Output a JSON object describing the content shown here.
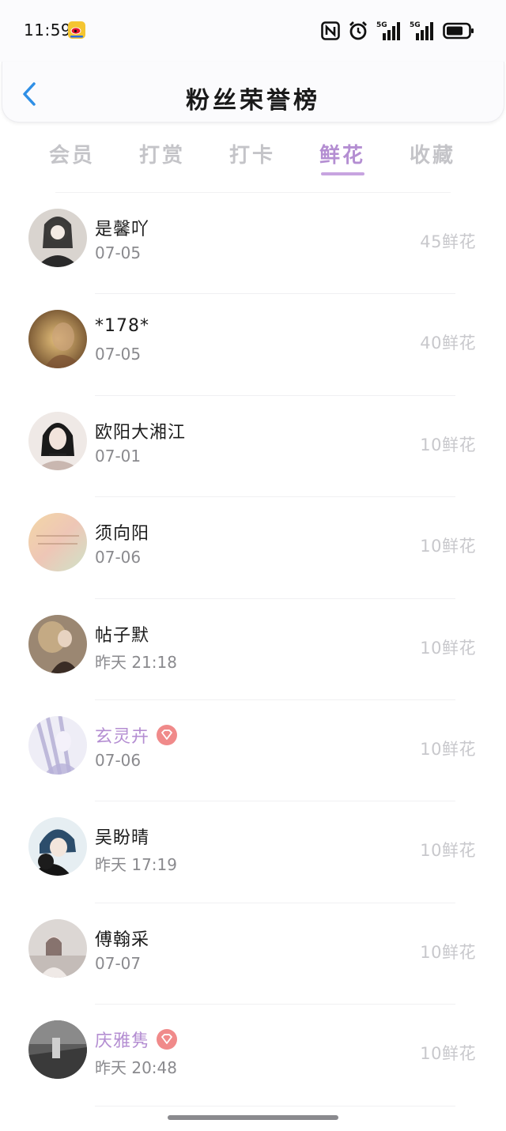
{
  "status_bar": {
    "time": "11:59",
    "icons": [
      "weibo-app-icon",
      "nfc-icon",
      "alarm-icon",
      "signal-5g-icon",
      "signal-5g-icon",
      "battery-icon"
    ],
    "signal_1_label": "5G",
    "signal_2_label": "5G"
  },
  "header": {
    "back_icon": "chevron-left-icon",
    "title": "粉丝荣誉榜"
  },
  "tabs": [
    {
      "label": "会员",
      "active": false
    },
    {
      "label": "打赏",
      "active": false
    },
    {
      "label": "打卡",
      "active": false
    },
    {
      "label": "鲜花",
      "active": true
    },
    {
      "label": "收藏",
      "active": false
    }
  ],
  "colors": {
    "accent": "#b48ed2",
    "tab_inactive": "#c4c4c8",
    "vip_badge": "#f08a8a",
    "date": "#8a8a8e",
    "flower_count": "#c8c8cc"
  },
  "fans": [
    {
      "name": "是馨吖",
      "date": "07-05",
      "flowers": "45鲜花",
      "vip": false
    },
    {
      "name": "*178*",
      "date": "07-05",
      "flowers": "40鲜花",
      "vip": false
    },
    {
      "name": "欧阳大湘江",
      "date": "07-01",
      "flowers": "10鲜花",
      "vip": false
    },
    {
      "name": "须向阳",
      "date": "07-06",
      "flowers": "10鲜花",
      "vip": false
    },
    {
      "name": "帖子默",
      "date": "昨天 21:18",
      "flowers": "10鲜花",
      "vip": false
    },
    {
      "name": "玄灵卉",
      "date": "07-06",
      "flowers": "10鲜花",
      "vip": true
    },
    {
      "name": "吴盼晴",
      "date": "昨天 17:19",
      "flowers": "10鲜花",
      "vip": false
    },
    {
      "name": "傅翰采",
      "date": "07-07",
      "flowers": "10鲜花",
      "vip": false
    },
    {
      "name": "庆雅隽",
      "date": "昨天 20:48",
      "flowers": "10鲜花",
      "vip": true
    }
  ]
}
